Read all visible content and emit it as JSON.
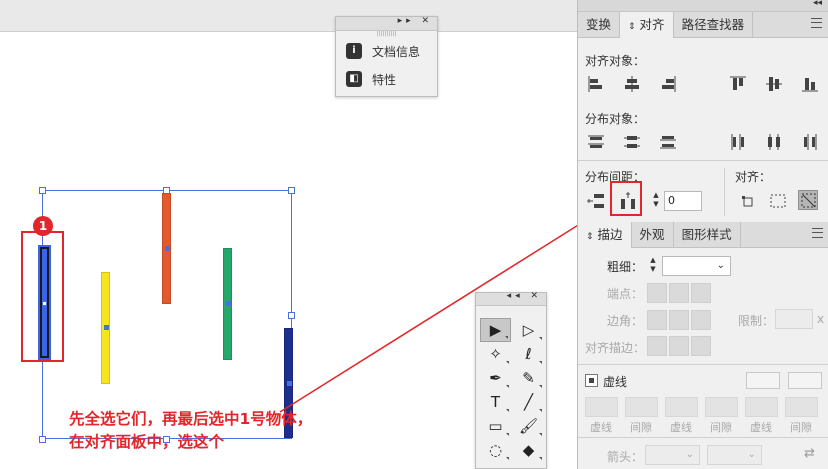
{
  "canvas": {
    "badge_number": "1",
    "instruction_line1": "先全选它们，再最后选中1号物体，",
    "instruction_line2": "在对齐面板中，选这个"
  },
  "colors": {
    "selection": "#4b6fe0",
    "annotation_red": "#e3262b",
    "bar_blue": "#3c64e6",
    "bar_yellow": "#f5e51e",
    "bar_orange": "#e35a2e",
    "bar_green": "#25a96b",
    "bar_navy": "#1d2e8f"
  },
  "mini_panel": {
    "controls": "▸▸ ✕",
    "items": [
      {
        "label": "文档信息",
        "icon": "info-icon"
      },
      {
        "label": "特性",
        "icon": "properties-icon"
      }
    ]
  },
  "tools_panel": {
    "controls": "◂◂ ✕",
    "tools": [
      {
        "name": "selection-tool",
        "glyph": "▶",
        "active": true
      },
      {
        "name": "direct-selection-tool",
        "glyph": "▷"
      },
      {
        "name": "magic-wand-tool",
        "glyph": "✧"
      },
      {
        "name": "lasso-tool",
        "glyph": "ℓ"
      },
      {
        "name": "pen-tool",
        "glyph": "✒"
      },
      {
        "name": "curvature-tool",
        "glyph": "✎"
      },
      {
        "name": "type-tool",
        "glyph": "T"
      },
      {
        "name": "line-tool",
        "glyph": "╱"
      },
      {
        "name": "rectangle-tool",
        "glyph": "▭"
      },
      {
        "name": "paintbrush-tool",
        "glyph": "🖌"
      },
      {
        "name": "shaper-tool",
        "glyph": "◌"
      },
      {
        "name": "eraser-tool",
        "glyph": "◆"
      }
    ]
  },
  "align_panel": {
    "top_controls": "◂◂",
    "tabs": [
      "变换",
      "对齐",
      "路径查找器"
    ],
    "active_tab": "对齐",
    "align_objects_label": "对齐对象：",
    "distribute_objects_label": "分布对象：",
    "distribute_spacing_label": "分布间距：",
    "align_to_label": "对齐：",
    "spacing_value": "0"
  },
  "stroke_panel": {
    "tabs": [
      "描边",
      "外观",
      "图形样式"
    ],
    "active_tab": "描边",
    "weight_label": "粗细：",
    "cap_label": "端点：",
    "corner_label": "边角：",
    "limit_label": "限制：",
    "limit_unit": "x",
    "align_stroke_label": "对齐描边：",
    "dashed_label": "虚线",
    "dash_labels": [
      "虚线",
      "间隙",
      "虚线",
      "间隙",
      "虚线",
      "间隙"
    ],
    "arrow_label": "箭头："
  }
}
